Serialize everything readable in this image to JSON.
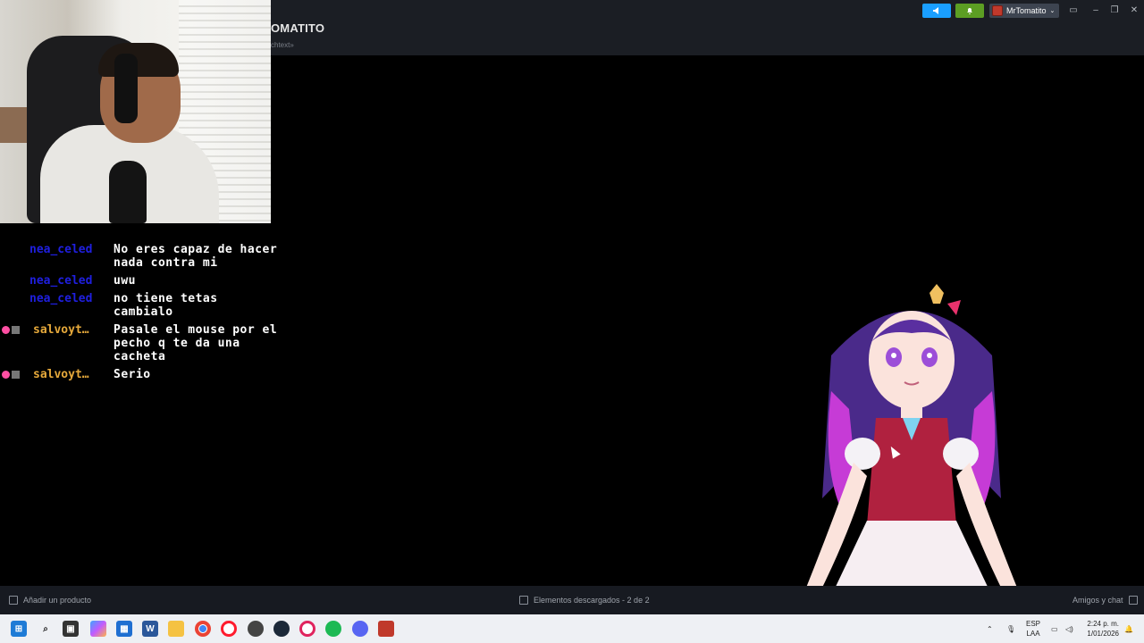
{
  "app": {
    "game_title": "OMATITO",
    "game_subtitle": "chtext»",
    "user_name": "MrTomatito"
  },
  "chat": [
    {
      "user": "nea_celed",
      "color": "blue",
      "badges": false,
      "text": "No eres capaz de hacer nada contra mi"
    },
    {
      "user": "nea_celed",
      "color": "blue",
      "badges": false,
      "text": "uwu"
    },
    {
      "user": "nea_celed",
      "color": "blue",
      "badges": false,
      "text": "no tiene tetas cambialo"
    },
    {
      "user": "salvoyt…",
      "color": "gold",
      "badges": true,
      "text": "Pasale el mouse por el pecho q te da una cacheta"
    },
    {
      "user": "salvoyt…",
      "color": "gold",
      "badges": true,
      "text": "Serio"
    }
  ],
  "statusbar": {
    "add_product": "Añadir un producto",
    "downloads": "Elementos descargados - 2 de 2",
    "friends": "Amigos y chat"
  },
  "taskbar": {
    "lang_top": "ESP",
    "lang_bottom": "LAA",
    "time": "2:24 p. m.",
    "date": "1/01/2026",
    "apps": [
      "windows-start",
      "search",
      "task-view",
      "copilot",
      "store",
      "word",
      "file-explorer",
      "chrome",
      "opera",
      "steam-alt",
      "steam",
      "opera-gx",
      "spotify",
      "discord",
      "tomatito-app"
    ]
  },
  "colors": {
    "steam_bar": "#1b1e24",
    "announce": "#1a9fff",
    "notify": "#5c9e23",
    "chat_blue": "#1f1fe0",
    "chat_gold": "#e6a93b"
  }
}
